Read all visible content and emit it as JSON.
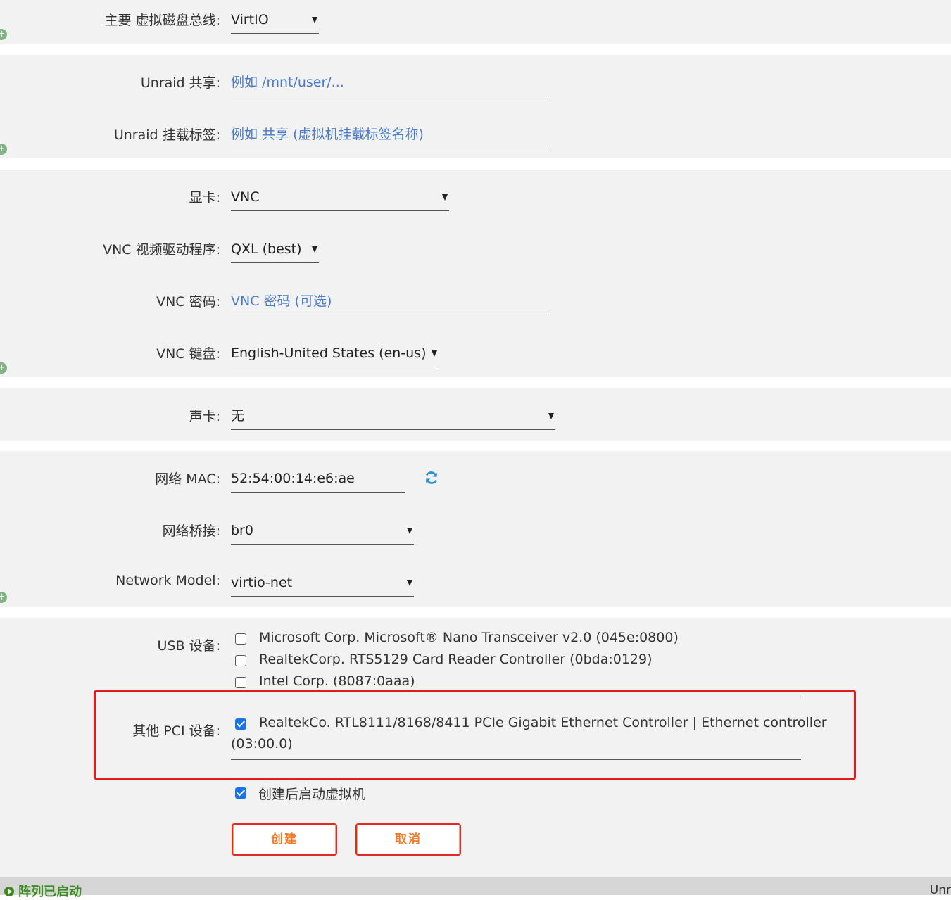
{
  "disk": {
    "bus_label": "主要 虚拟磁盘总线:",
    "bus_value": "VirtIO"
  },
  "share": {
    "unraid_share_label": "Unraid 共享:",
    "unraid_share_placeholder": "例如 /mnt/user/...",
    "mount_tag_label": "Unraid 挂载标签:",
    "mount_tag_placeholder": "例如 共享 (虚拟机挂载标签名称)"
  },
  "graphics": {
    "gpu_label": "显卡:",
    "gpu_value": "VNC",
    "vnc_driver_label": "VNC 视频驱动程序:",
    "vnc_driver_value": "QXL (best)",
    "vnc_password_label": "VNC 密码:",
    "vnc_password_placeholder": "VNC 密码 (可选)",
    "vnc_keyboard_label": "VNC 键盘:",
    "vnc_keyboard_value": "English-United States (en-us)"
  },
  "sound": {
    "label": "声卡:",
    "value": "无"
  },
  "network": {
    "mac_label": "网络 MAC:",
    "mac_value": "52:54:00:14:e6:ae",
    "bridge_label": "网络桥接:",
    "bridge_value": "br0",
    "model_label": "Network Model:",
    "model_value": "virtio-net"
  },
  "usb": {
    "label": "USB 设备:",
    "devices": [
      {
        "name": "Microsoft Corp. Microsoft® Nano Transceiver v2.0 (045e:0800)",
        "checked": false
      },
      {
        "name": "RealtekCorp. RTS5129 Card Reader Controller (0bda:0129)",
        "checked": false
      },
      {
        "name": "Intel Corp. (8087:0aaa)",
        "checked": false
      }
    ]
  },
  "pci": {
    "label": "其他 PCI 设备:",
    "device_line1": "RealtekCo. RTL8111/8168/8411 PCIe Gigabit Ethernet Controller | Ethernet controller",
    "device_line2": "(03:00.0)",
    "checked": true
  },
  "start_after_create": {
    "label": "创建后启动虚拟机",
    "checked": true
  },
  "buttons": {
    "create": "创建",
    "cancel": "取消"
  },
  "footer": {
    "status": "阵列已启动",
    "right_text": "Unr"
  },
  "colors": {
    "highlight_box": "#e51a1a",
    "accent": "#1a73e8",
    "status_green": "#3c8a20"
  },
  "icons": {
    "section_add": "plus-circle-icon",
    "mac_refresh": "refresh-icon",
    "footer_status": "play-circle-icon"
  }
}
